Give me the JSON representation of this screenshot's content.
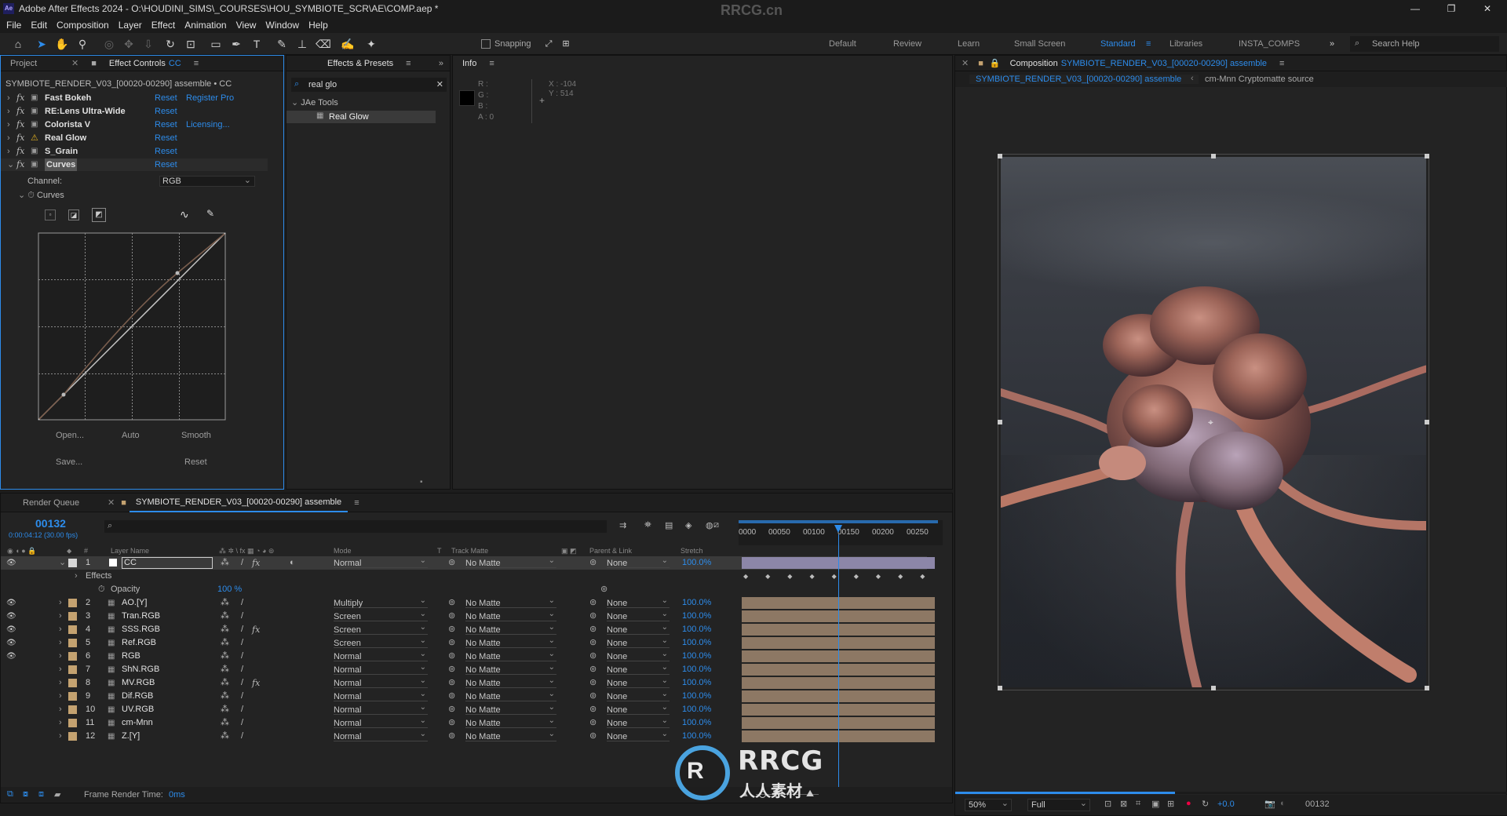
{
  "title": "Adobe After Effects 2024 - O:\\HOUDINI_SIMS\\_COURSES\\HOU_SYMBIOTE_SCR\\AE\\COMP.aep *",
  "watermark": "RRCG.cn",
  "menu": [
    "File",
    "Edit",
    "Composition",
    "Layer",
    "Effect",
    "Animation",
    "View",
    "Window",
    "Help"
  ],
  "toolbar": {
    "snapping": "Snapping",
    "search_help": "Search Help"
  },
  "workspaces": [
    "Default",
    "Review",
    "Learn",
    "Small Screen",
    "Standard",
    "Libraries",
    "INSTA_COMPS"
  ],
  "left_panel": {
    "tabs": [
      "Project",
      "Effect Controls",
      "CC"
    ],
    "subtitle": "SYMBIOTE_RENDER_V03_[00020-00290] assemble • CC",
    "effects": [
      {
        "name": "Fast Bokeh",
        "reset": "Reset",
        "extra": "Register Pro"
      },
      {
        "name": "RE:Lens Ultra-Wide",
        "reset": "Reset",
        "extra": ""
      },
      {
        "name": "Colorista V",
        "reset": "Reset",
        "extra": "Licensing..."
      },
      {
        "name": "Real Glow",
        "reset": "Reset",
        "extra": ""
      },
      {
        "name": "S_Grain",
        "reset": "Reset",
        "extra": ""
      },
      {
        "name": "Curves",
        "reset": "Reset",
        "extra": ""
      }
    ],
    "channel_label": "Channel:",
    "channel_value": "RGB",
    "curves_label": "Curves",
    "buttons": {
      "open": "Open...",
      "auto": "Auto",
      "smooth": "Smooth",
      "save": "Save...",
      "reset": "Reset"
    }
  },
  "effects_presets": {
    "tab": "Effects & Presets",
    "search": "real glo",
    "folder": "JAe Tools",
    "item": "Real Glow"
  },
  "info": {
    "tab": "Info",
    "r": "R :",
    "g": "G :",
    "b": "B :",
    "a": "A :  0",
    "x": "X : -104",
    "y": "Y :  514"
  },
  "composition": {
    "tab_label": "Composition",
    "comp_name": "SYMBIOTE_RENDER_V03_[00020-00290] assemble",
    "breadcrumb_1": "SYMBIOTE_RENDER_V03_[00020-00290] assemble",
    "breadcrumb_2": "cm-Mnn Cryptomatte source",
    "zoom": "50%",
    "resolution": "Full",
    "exposure": "+0.0",
    "frame": "00132"
  },
  "timeline": {
    "tabs": [
      "Render Queue",
      "SYMBIOTE_RENDER_V03_[00020-00290] assemble"
    ],
    "current_frame": "00132",
    "timecode": "0:00:04:12 (30.00 fps)",
    "headers": {
      "layer_name": "Layer Name",
      "mode": "Mode",
      "t": "T",
      "track_matte": "Track Matte",
      "parent": "Parent & Link",
      "stretch": "Stretch"
    },
    "ruler": [
      "0000",
      "00050",
      "00100",
      "00150",
      "00200",
      "00250"
    ],
    "effects_label": "Effects",
    "opacity_label": "Opacity",
    "opacity_value": "100 %",
    "layers": [
      {
        "num": "1",
        "name": "CC",
        "mode": "Normal",
        "matte": "No Matte",
        "parent": "None",
        "stretch": "100.0%"
      },
      {
        "num": "2",
        "name": "AO.[Y]",
        "mode": "Multiply",
        "matte": "No Matte",
        "parent": "None",
        "stretch": "100.0%"
      },
      {
        "num": "3",
        "name": "Tran.RGB",
        "mode": "Screen",
        "matte": "No Matte",
        "parent": "None",
        "stretch": "100.0%"
      },
      {
        "num": "4",
        "name": "SSS.RGB",
        "mode": "Screen",
        "matte": "No Matte",
        "parent": "None",
        "stretch": "100.0%"
      },
      {
        "num": "5",
        "name": "Ref.RGB",
        "mode": "Screen",
        "matte": "No Matte",
        "parent": "None",
        "stretch": "100.0%"
      },
      {
        "num": "6",
        "name": "RGB",
        "mode": "Normal",
        "matte": "No Matte",
        "parent": "None",
        "stretch": "100.0%"
      },
      {
        "num": "7",
        "name": "ShN.RGB",
        "mode": "Normal",
        "matte": "No Matte",
        "parent": "None",
        "stretch": "100.0%"
      },
      {
        "num": "8",
        "name": "MV.RGB",
        "mode": "Normal",
        "matte": "No Matte",
        "parent": "None",
        "stretch": "100.0%"
      },
      {
        "num": "9",
        "name": "Dif.RGB",
        "mode": "Normal",
        "matte": "No Matte",
        "parent": "None",
        "stretch": "100.0%"
      },
      {
        "num": "10",
        "name": "UV.RGB",
        "mode": "Normal",
        "matte": "No Matte",
        "parent": "None",
        "stretch": "100.0%"
      },
      {
        "num": "11",
        "name": "cm-Mnn",
        "mode": "Normal",
        "matte": "No Matte",
        "parent": "None",
        "stretch": "100.0%"
      },
      {
        "num": "12",
        "name": "Z.[Y]",
        "mode": "Normal",
        "matte": "No Matte",
        "parent": "None",
        "stretch": "100.0%"
      }
    ],
    "render_time_label": "Frame Render Time:",
    "render_time_value": "0ms"
  },
  "logo": {
    "text_main": "RRCG",
    "text_sub": "人人素材"
  }
}
